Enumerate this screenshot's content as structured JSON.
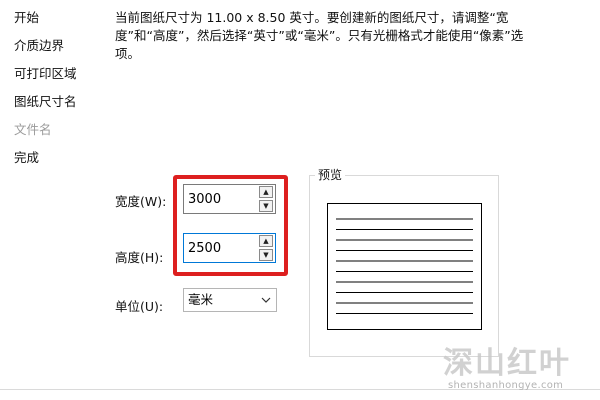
{
  "sidebar": {
    "items": [
      {
        "label": "开始"
      },
      {
        "label": "介质边界"
      },
      {
        "label": "可打印区域"
      },
      {
        "label": "图纸尺寸名"
      },
      {
        "label": "文件名"
      },
      {
        "label": "完成"
      }
    ]
  },
  "description": "当前图纸尺寸为 11.00 x 8.50 英寸。要创建新的图纸尺寸，请调整“宽度”和“高度”，然后选择“英寸”或“毫米”。只有光栅格式才能使用“像素”选项。",
  "form": {
    "width_label": "宽度(W):",
    "width_value": "3000",
    "height_label": "高度(H):",
    "height_value": "2500",
    "unit_label": "单位(U):",
    "unit_value": "毫米"
  },
  "preview": {
    "title": "预览",
    "line_count": 10
  },
  "watermark": {
    "logo_text": "深山红叶",
    "url": "shenshanhongye.com"
  },
  "colors": {
    "highlight": "#dd1f1f",
    "focus_border": "#0078d7",
    "disabled_text": "#9a9a9a"
  }
}
